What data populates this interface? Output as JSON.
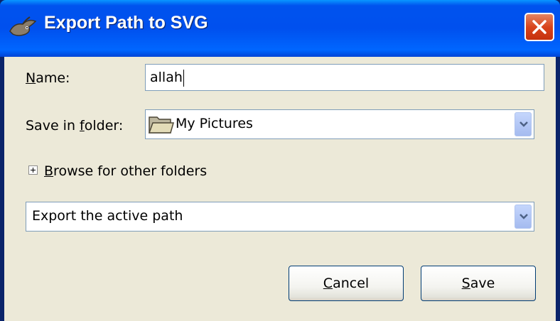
{
  "window": {
    "title": "Export Path to SVG",
    "app_icon": "gimp-icon",
    "close_icon": "close-icon"
  },
  "form": {
    "name_label_key": "N",
    "name_label_rest": "ame:",
    "name_value": "allah",
    "folder_label_pre": "Save in ",
    "folder_label_key": "f",
    "folder_label_rest": "older:",
    "folder_value": "My Pictures",
    "folder_icon": "folder-icon",
    "browse_key": "B",
    "browse_rest": "rowse for other folders",
    "export_option": "Export the active path"
  },
  "buttons": {
    "cancel_key": "C",
    "cancel_rest": "ancel",
    "save_key": "S",
    "save_rest": "ave"
  },
  "colors": {
    "titlebar": "#0054e3",
    "dialog_bg": "#ece9d8",
    "close": "#d9441c"
  }
}
